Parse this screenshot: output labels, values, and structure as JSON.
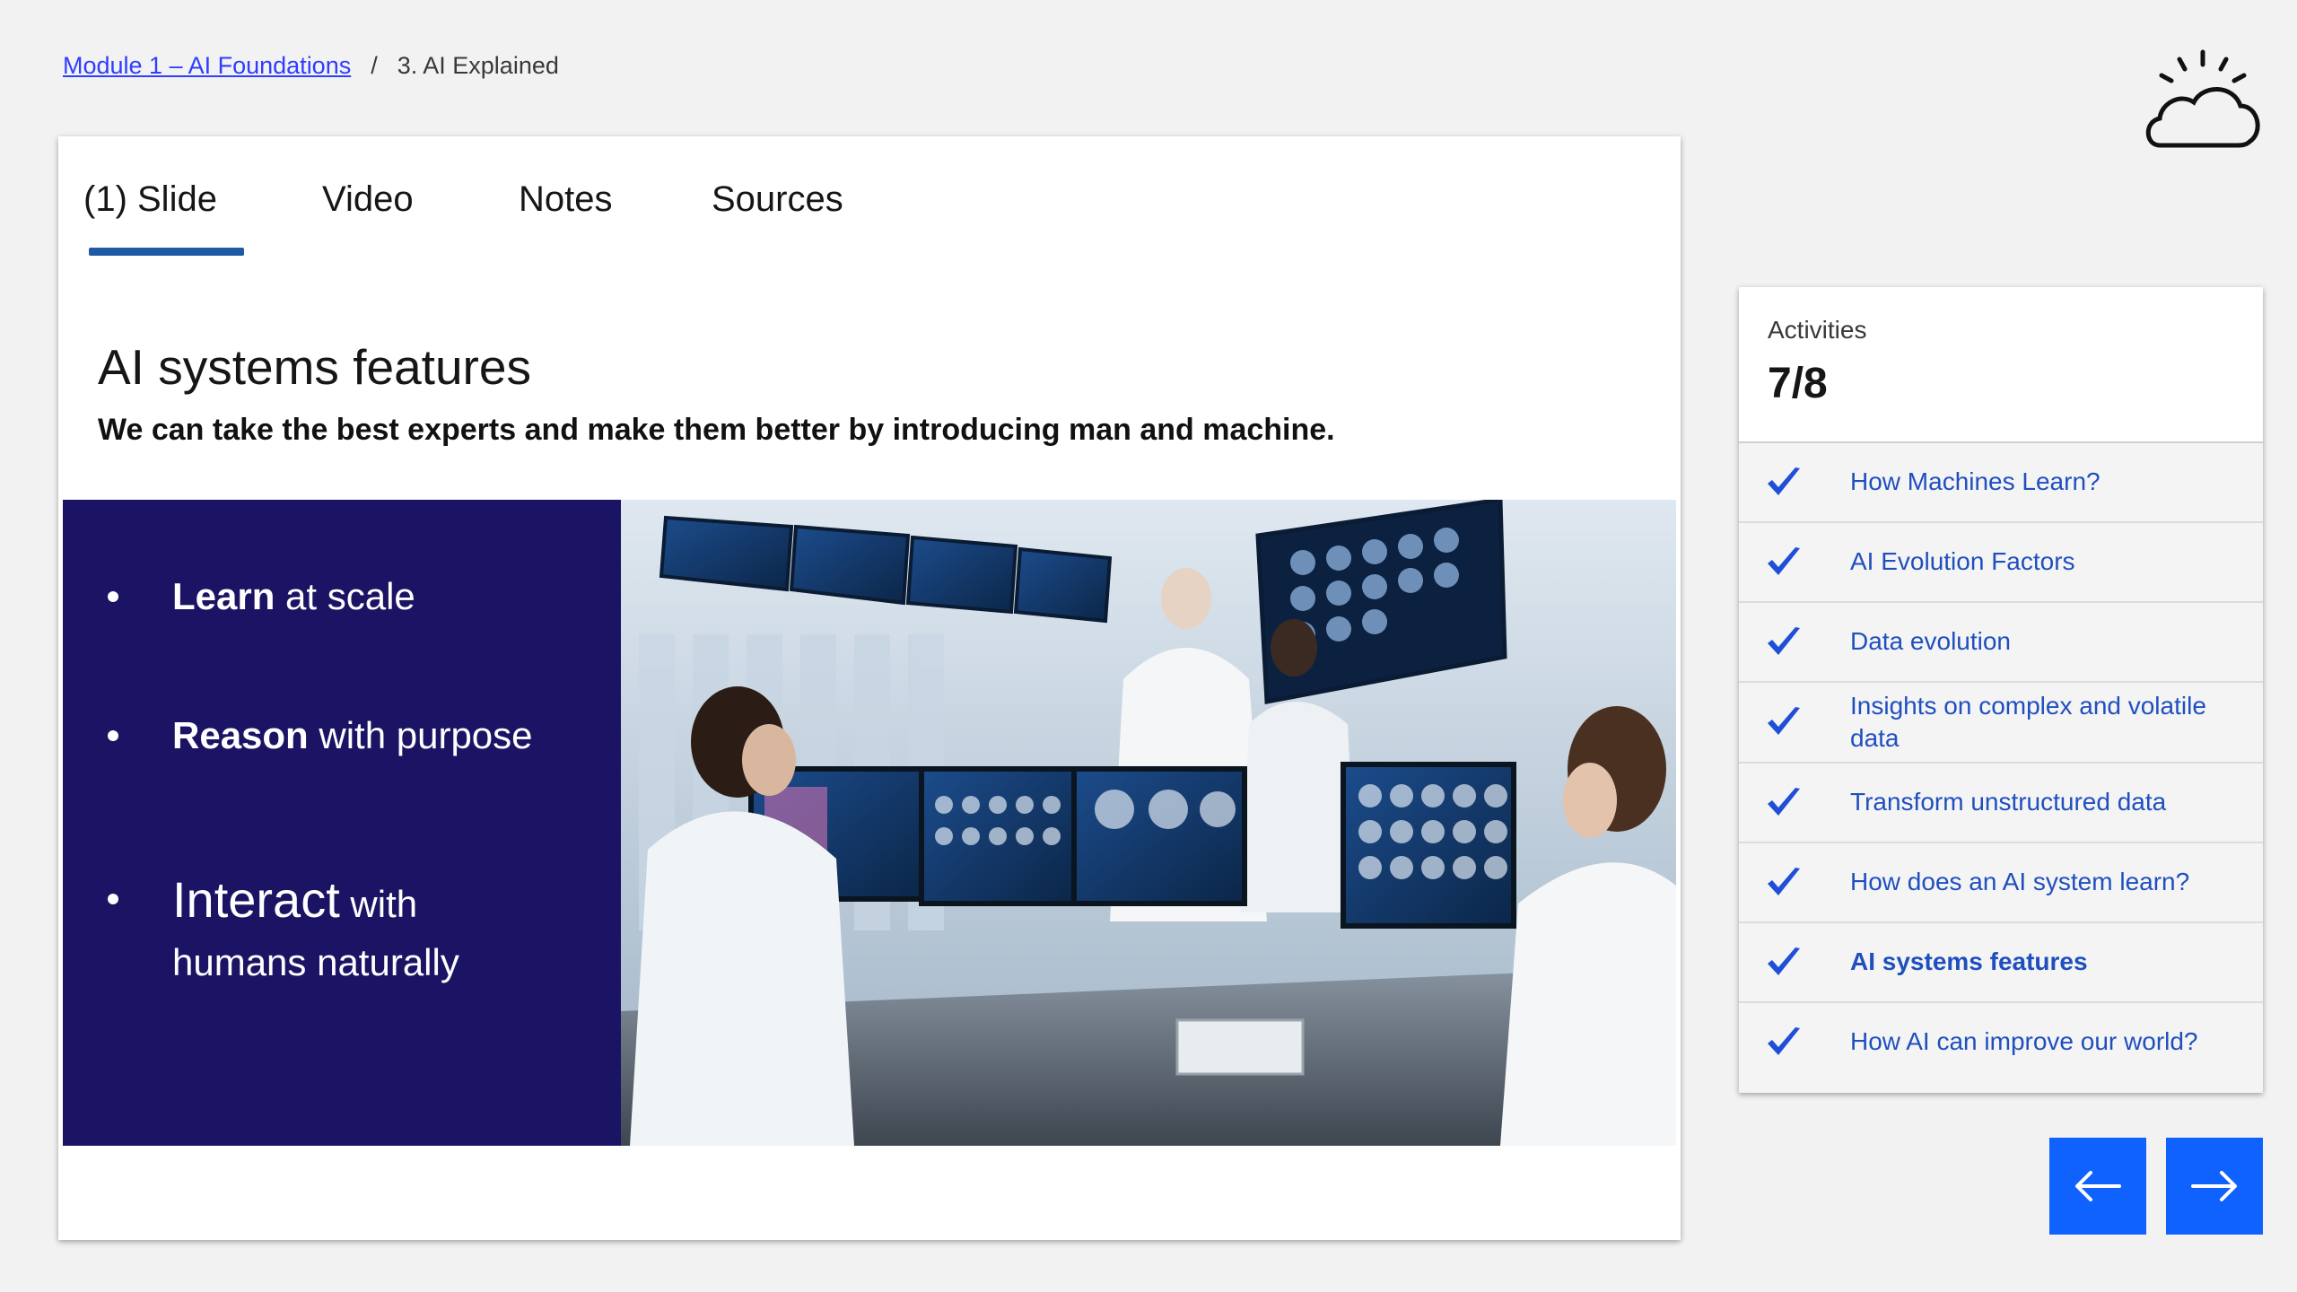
{
  "breadcrumb": {
    "module_link": "Module 1 – AI Foundations",
    "separator": "/",
    "current": "3. AI Explained"
  },
  "logo": {
    "icon": "cloud-sun-icon"
  },
  "tabs": [
    {
      "label": "(1) Slide",
      "active": true
    },
    {
      "label": "Video",
      "active": false
    },
    {
      "label": "Notes",
      "active": false
    },
    {
      "label": "Sources",
      "active": false
    }
  ],
  "slide": {
    "title": "AI systems features",
    "subtitle": "We can take the best experts and make them better by introducing man and machine.",
    "features": [
      {
        "bold": "Learn",
        "rest": " at scale"
      },
      {
        "bold": "Reason",
        "rest": " with purpose"
      },
      {
        "bold": "Interact",
        "rest": " with",
        "rest2": "humans naturally"
      }
    ],
    "photo_alt": "Medical researchers analyzing brain scans on multiple monitors"
  },
  "activities": {
    "label": "Activities",
    "count": "7/8",
    "items": [
      {
        "title": "How Machines Learn?",
        "done": true,
        "current": false
      },
      {
        "title": "AI Evolution Factors",
        "done": true,
        "current": false
      },
      {
        "title": "Data evolution",
        "done": true,
        "current": false
      },
      {
        "title": "Insights on complex and volatile data",
        "done": true,
        "current": false
      },
      {
        "title": "Transform unstructured data",
        "done": true,
        "current": false
      },
      {
        "title": "How does an AI system learn?",
        "done": true,
        "current": false
      },
      {
        "title": "AI systems features",
        "done": true,
        "current": true
      },
      {
        "title": "How AI can improve our world?",
        "done": true,
        "current": false
      }
    ]
  },
  "nav": {
    "prev_icon": "arrow-left-icon",
    "next_icon": "arrow-right-icon"
  },
  "colors": {
    "accent": "#0f62fe",
    "feature_bg": "#1b1464",
    "tab_underline": "#1f5aa6",
    "link": "#1f4fbf"
  }
}
